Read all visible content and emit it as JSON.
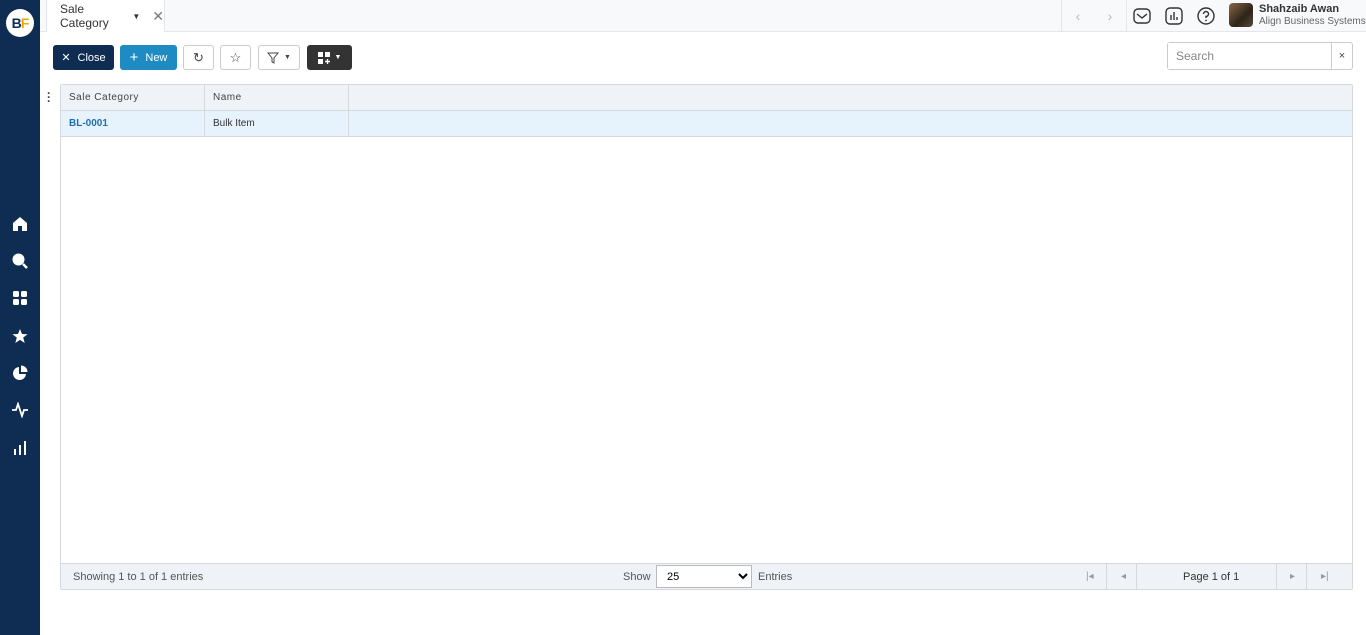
{
  "app": {
    "logo": "BF",
    "brand_color": "#0f2d52",
    "accent_color": "#1e8bc3"
  },
  "sidebar": {
    "items": [
      {
        "icon": "home-icon"
      },
      {
        "icon": "search-icon"
      },
      {
        "icon": "apps-icon"
      },
      {
        "icon": "star-icon"
      },
      {
        "icon": "pie-chart-icon"
      },
      {
        "icon": "activity-icon"
      },
      {
        "icon": "bar-chart-icon"
      }
    ]
  },
  "topbar": {
    "tab_label": "Sale Category",
    "user_name": "Shahzaib Awan",
    "user_org": "Align Business Systems"
  },
  "toolbar": {
    "close_label": "Close",
    "new_label": "New",
    "search_placeholder": "Search",
    "search_value": "",
    "search_clear": "×"
  },
  "table": {
    "columns": [
      "Sale Category",
      "Name"
    ],
    "rows": [
      {
        "code": "BL-0001",
        "name": "Bulk Item"
      }
    ]
  },
  "footer": {
    "showing": "Showing 1 to 1 of 1 entries",
    "show_label": "Show",
    "page_size": "25",
    "entries_label": "Entries",
    "page_text": "Page 1 of 1"
  }
}
